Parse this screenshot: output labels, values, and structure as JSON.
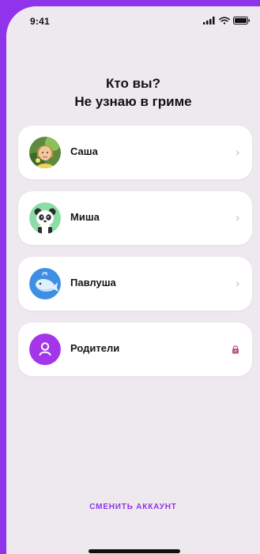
{
  "status_bar": {
    "time": "9:41",
    "icons": [
      "signal-icon",
      "wifi-icon",
      "battery-icon"
    ]
  },
  "title": {
    "line1": "Кто вы?",
    "line2": "Не узнаю в гриме"
  },
  "profiles": [
    {
      "name": "Саша",
      "avatar": "child-photo-avatar",
      "action": "chevron-right-icon"
    },
    {
      "name": "Миша",
      "avatar": "panda-avatar",
      "action": "chevron-right-icon"
    },
    {
      "name": "Павлуша",
      "avatar": "whale-avatar",
      "action": "chevron-right-icon"
    },
    {
      "name": "Родители",
      "avatar": "parent-user-avatar",
      "action": "lock-icon"
    }
  ],
  "footer": {
    "switch_account_label": "СМЕНИТЬ АККАУНТ"
  },
  "colors": {
    "accent": "#8f34ea",
    "background": "#ede9ee",
    "card": "#ffffff"
  }
}
